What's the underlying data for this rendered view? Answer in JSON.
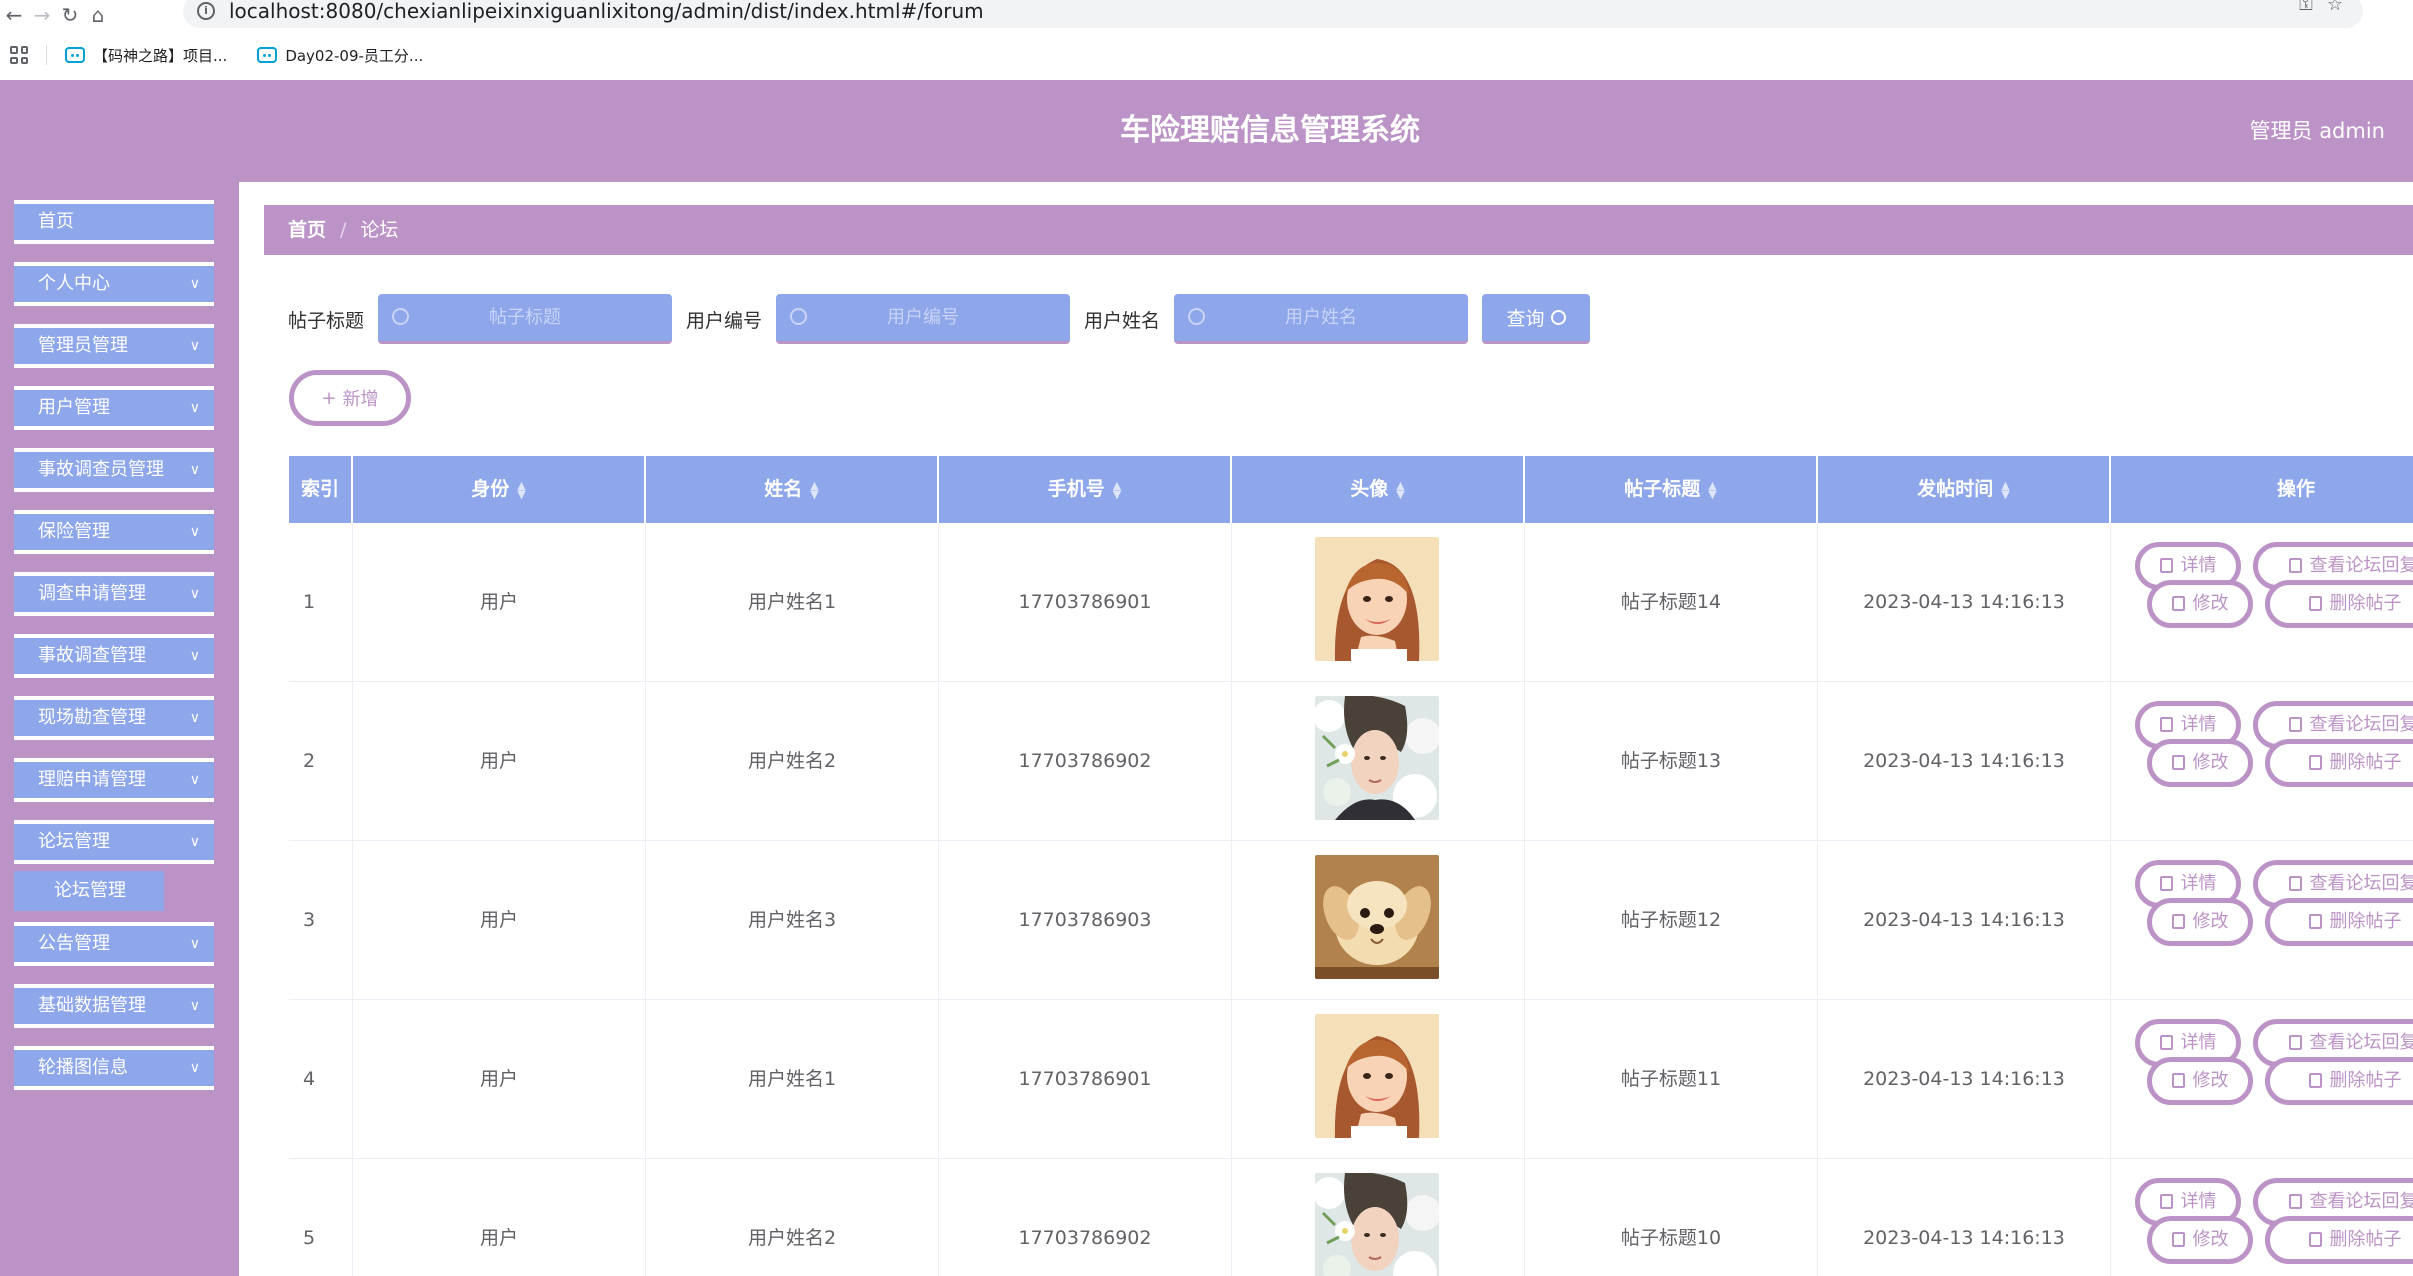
{
  "browser": {
    "url": "localhost:8080/chexianlipeixinxiguanlixitong/admin/dist/index.html#/forum",
    "bookmarks": [
      "【码神之路】项目...",
      "Day02-09-员工分..."
    ]
  },
  "header": {
    "title": "车险理赔信息管理系统",
    "user": "管理员 admin"
  },
  "sidebar": {
    "items": [
      {
        "label": "首页"
      },
      {
        "label": "个人中心"
      },
      {
        "label": "管理员管理"
      },
      {
        "label": "用户管理"
      },
      {
        "label": "事故调查员管理"
      },
      {
        "label": "保险管理"
      },
      {
        "label": "调查申请管理"
      },
      {
        "label": "事故调查管理"
      },
      {
        "label": "现场勘查管理"
      },
      {
        "label": "理赔申请管理"
      },
      {
        "label": "论坛管理"
      },
      {
        "label": "公告管理"
      },
      {
        "label": "基础数据管理"
      },
      {
        "label": "轮播图信息"
      }
    ],
    "sub_item": "论坛管理"
  },
  "breadcrumb": {
    "home": "首页",
    "current": "论坛"
  },
  "search": {
    "title_label": "帖子标题",
    "title_placeholder": "帖子标题",
    "uid_label": "用户编号",
    "uid_placeholder": "用户编号",
    "uname_label": "用户姓名",
    "uname_placeholder": "用户姓名",
    "query_label": "查询"
  },
  "add_button": "新增",
  "table": {
    "headers": [
      "索引",
      "身份",
      "姓名",
      "手机号",
      "头像",
      "帖子标题",
      "发帖时间",
      "操作"
    ],
    "actions": {
      "detail": "详情",
      "view_replies": "查看论坛回复",
      "edit": "修改",
      "delete": "删除帖子"
    },
    "rows": [
      {
        "index": "1",
        "role": "用户",
        "name": "用户姓名1",
        "phone": "17703786901",
        "avatar": "woman-portrait",
        "title": "帖子标题14",
        "time": "2023-04-13 14:16:13"
      },
      {
        "index": "2",
        "role": "用户",
        "name": "用户姓名2",
        "phone": "17703786902",
        "avatar": "man-flowers-portrait",
        "title": "帖子标题13",
        "time": "2023-04-13 14:16:13"
      },
      {
        "index": "3",
        "role": "用户",
        "name": "用户姓名3",
        "phone": "17703786903",
        "avatar": "puppy",
        "title": "帖子标题12",
        "time": "2023-04-13 14:16:13"
      },
      {
        "index": "4",
        "role": "用户",
        "name": "用户姓名1",
        "phone": "17703786901",
        "avatar": "woman-portrait",
        "title": "帖子标题11",
        "time": "2023-04-13 14:16:13"
      },
      {
        "index": "5",
        "role": "用户",
        "name": "用户姓名2",
        "phone": "17703786902",
        "avatar": "man-flowers-portrait",
        "title": "帖子标题10",
        "time": "2023-04-13 14:16:13"
      }
    ]
  },
  "colors": {
    "primary": "#bc93c6",
    "accent": "#8ea6ea"
  }
}
